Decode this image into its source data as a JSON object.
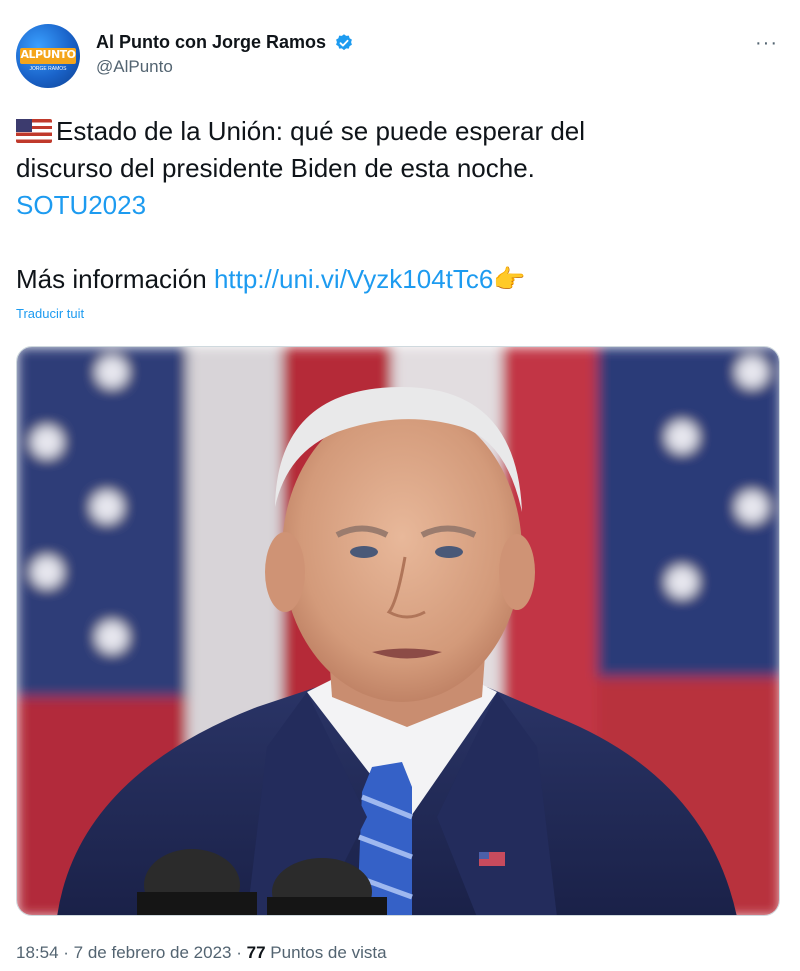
{
  "author": {
    "display_name": "Al Punto con Jorge Ramos",
    "handle": "@AlPunto",
    "avatar_text": "ALPUNTO",
    "avatar_subtext": "JORGE RAMOS"
  },
  "icons": {
    "verified": "verified-badge-icon",
    "more": "more-options-icon",
    "flag": "us-flag-emoji",
    "pointing": "pointing-hand-emoji"
  },
  "tweet": {
    "line1": "Estado de la Unión: qué se puede esperar del",
    "line2": "discurso del presidente Biden de esta noche.",
    "hashtag": "SOTU2023",
    "more_info_label": "Más información",
    "url": "http://uni.vi/Vyzk104tTc6",
    "pointing_emoji": "👉",
    "translate_label": "Traducir tuit"
  },
  "meta": {
    "time": "18:54",
    "separator": " · ",
    "date": "7 de febrero de 2023",
    "views_count": "77",
    "views_label": "Puntos de vista"
  },
  "colors": {
    "link": "#1d9bf0",
    "secondary_text": "#536471",
    "primary_text": "#0f1419",
    "verified": "#1d9bf0"
  }
}
